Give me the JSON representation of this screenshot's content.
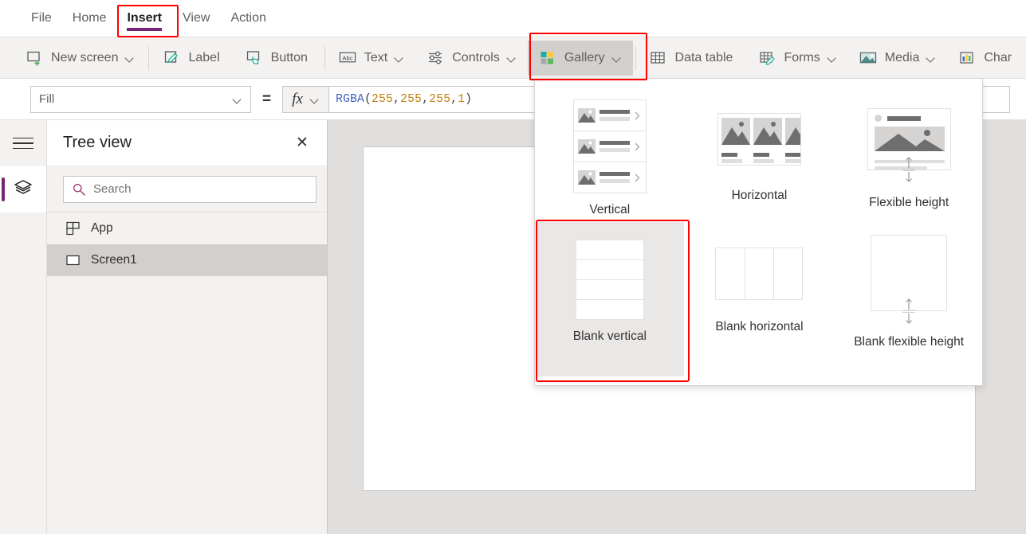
{
  "menubar": {
    "items": [
      {
        "label": "File",
        "active": false
      },
      {
        "label": "Home",
        "active": false
      },
      {
        "label": "Insert",
        "active": true
      },
      {
        "label": "View",
        "active": false
      },
      {
        "label": "Action",
        "active": false
      }
    ],
    "active_underline_color": "#742774",
    "highlight_color": "#ff0000"
  },
  "ribbon": {
    "items": [
      {
        "label": "New screen",
        "icon": "new-screen-icon",
        "caret": true
      },
      {
        "label": "Label",
        "icon": "label-icon",
        "caret": false
      },
      {
        "label": "Button",
        "icon": "button-icon",
        "caret": false
      },
      {
        "label": "Text",
        "icon": "text-abc-icon",
        "caret": true
      },
      {
        "label": "Controls",
        "icon": "controls-sliders-icon",
        "caret": true
      },
      {
        "label": "Gallery",
        "icon": "gallery-squares-icon",
        "caret": true,
        "active": true
      },
      {
        "label": "Data table",
        "icon": "data-table-icon",
        "caret": false
      },
      {
        "label": "Forms",
        "icon": "forms-icon",
        "caret": true
      },
      {
        "label": "Media",
        "icon": "media-image-icon",
        "caret": true
      },
      {
        "label": "Char",
        "icon": "charts-bar-icon",
        "caret": false
      }
    ],
    "gallery_icon_colors": {
      "top_left": "#1aaf9e",
      "top_right": "#ffc83d",
      "bottom_left": "#a6a6a6",
      "bottom_right": "#5cb85c"
    }
  },
  "formula_bar": {
    "property": "Fill",
    "equals": "=",
    "fx_label": "fx",
    "formula_tokens": [
      {
        "text": "RGBA",
        "type": "fn"
      },
      {
        "text": "(",
        "type": "punc"
      },
      {
        "text": "255",
        "type": "num"
      },
      {
        "text": ", ",
        "type": "punc"
      },
      {
        "text": "255",
        "type": "num"
      },
      {
        "text": ", ",
        "type": "punc"
      },
      {
        "text": "255",
        "type": "num"
      },
      {
        "text": ", ",
        "type": "punc"
      },
      {
        "text": "1",
        "type": "num"
      },
      {
        "text": ")",
        "type": "punc"
      }
    ],
    "formula_text": "RGBA(255, 255, 255, 1)"
  },
  "rail": {
    "hamburger": "hamburger-menu-icon",
    "items": [
      {
        "name": "tree-view",
        "icon": "layers-icon",
        "selected": true
      }
    ],
    "accent_color": "#742774"
  },
  "tree_view": {
    "title": "Tree view",
    "close_label": "✕",
    "search": {
      "placeholder": "Search",
      "icon": "search-icon",
      "icon_color": "#a4262c"
    },
    "rows": [
      {
        "label": "App",
        "icon": "app-icon",
        "selected": false
      },
      {
        "label": "Screen1",
        "icon": "screen-icon",
        "selected": true
      }
    ]
  },
  "gallery_flyout": {
    "items": [
      {
        "label": "Vertical",
        "thumb": "vertical-gallery-thumb",
        "selected": false
      },
      {
        "label": "Horizontal",
        "thumb": "horizontal-gallery-thumb",
        "selected": false
      },
      {
        "label": "Flexible height",
        "thumb": "flexible-height-gallery-thumb",
        "selected": false
      },
      {
        "label": "Blank vertical",
        "thumb": "blank-vertical-gallery-thumb",
        "selected": true
      },
      {
        "label": "Blank horizontal",
        "thumb": "blank-horizontal-gallery-thumb",
        "selected": false
      },
      {
        "label": "Blank flexible height",
        "thumb": "blank-flexible-gallery-thumb",
        "selected": false
      }
    ],
    "highlight_color": "#ff0000"
  },
  "canvas": {
    "screen_name": "Screen1",
    "background": "#e1dfdd",
    "screen_fill": "#ffffff"
  }
}
